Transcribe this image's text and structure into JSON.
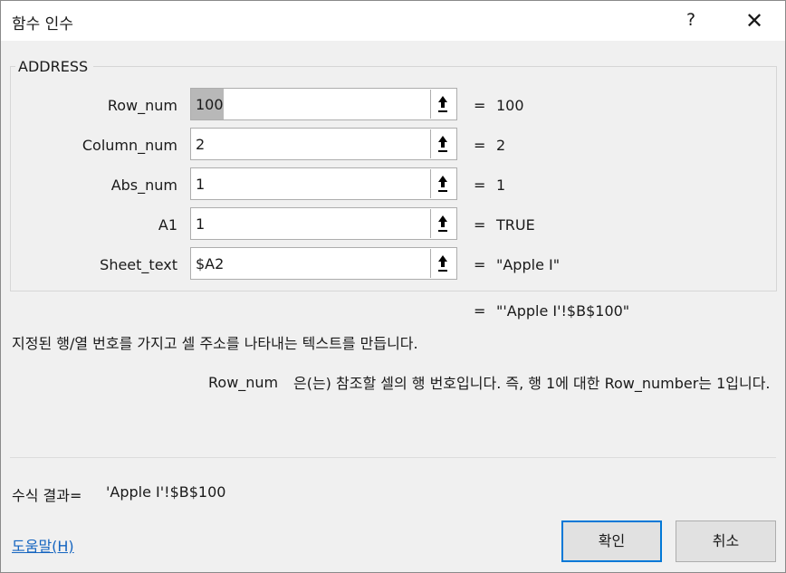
{
  "window": {
    "title": "함수 인수",
    "help_glyph": "?",
    "close_glyph": "✕"
  },
  "function_group": {
    "name": "ADDRESS"
  },
  "arguments": [
    {
      "label": "Row_num",
      "value": "100",
      "result": "100",
      "equals": "="
    },
    {
      "label": "Column_num",
      "value": "2",
      "result": "2",
      "equals": "="
    },
    {
      "label": "Abs_num",
      "value": "1",
      "result": "1",
      "equals": "="
    },
    {
      "label": "A1",
      "value": "1",
      "result": "TRUE",
      "equals": "="
    },
    {
      "label": "Sheet_text",
      "value": "$A2",
      "result": "\"Apple I\"",
      "equals": "="
    }
  ],
  "function_result": {
    "equals": "=",
    "value": "\"'Apple I'!$B$100\""
  },
  "description": "지정된 행/열 번호를 가지고 셀 주소를 나타내는 텍스트를 만듭니다.",
  "argument_help": {
    "name": "Row_num",
    "text": "은(는) 참조할 셀의 행 번호입니다. 즉, 행 1에 대한 Row_number는 1입니다."
  },
  "formula_result": {
    "label": "수식 결과=",
    "value": "'Apple I'!$B$100"
  },
  "help_link": "도움말(H)",
  "buttons": {
    "ok": "확인",
    "cancel": "취소"
  },
  "icons": {
    "ref_button": "collapse-dialog-arrow-icon",
    "close": "close-icon",
    "help": "help-icon"
  },
  "colors": {
    "link": "#1565c0",
    "default_button_border": "#0078d7"
  }
}
